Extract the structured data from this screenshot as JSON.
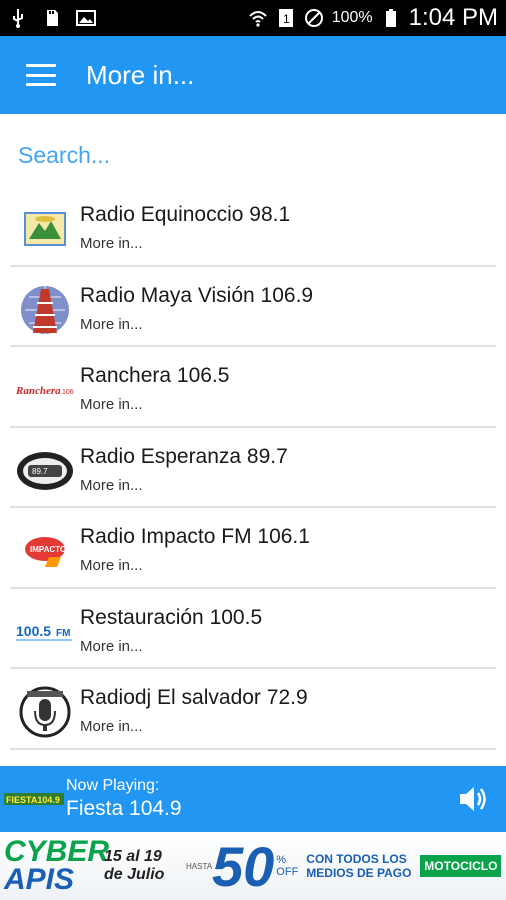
{
  "status_bar": {
    "icons_left": [
      "usb-icon",
      "sd-card-icon",
      "image-icon"
    ],
    "battery_percent": "100%",
    "time": "1:04 PM"
  },
  "app_bar": {
    "title": "More in..."
  },
  "search": {
    "placeholder": "Search..."
  },
  "stations": [
    {
      "title": "Radio Equinoccio 98.1",
      "subtitle": "More in...",
      "logo": "equinoccio-logo"
    },
    {
      "title": "Radio Maya Visión 106.9",
      "subtitle": "More in...",
      "logo": "maya-vision-logo"
    },
    {
      "title": "Ranchera 106.5",
      "subtitle": "More in...",
      "logo": "ranchera-logo"
    },
    {
      "title": "Radio Esperanza 89.7",
      "subtitle": "More in...",
      "logo": "esperanza-logo"
    },
    {
      "title": "Radio Impacto FM 106.1",
      "subtitle": "More in...",
      "logo": "impacto-logo"
    },
    {
      "title": "Restauración 100.5",
      "subtitle": "More in...",
      "logo": "restauracion-logo"
    },
    {
      "title": "Radiodj El salvador 72.9",
      "subtitle": "More in...",
      "logo": "radiodj-logo"
    }
  ],
  "player": {
    "label": "Now Playing:",
    "station": "Fiesta 104.9"
  },
  "ad": {
    "brand_top": "CYBER",
    "brand_bottom": "APIS",
    "dates_line1": "15 al 19",
    "dates_line2": "de Julio",
    "hasta": "HASTA",
    "big_number": "50",
    "off": "% OFF",
    "pago": "CON TODOS LOS MEDIOS DE PAGO",
    "motociclo": "MOTOCICLO"
  },
  "colors": {
    "primary": "#2196f3",
    "search_text": "#42a5f5",
    "ad_green": "#0aa24a",
    "ad_blue": "#1a5fb4"
  }
}
